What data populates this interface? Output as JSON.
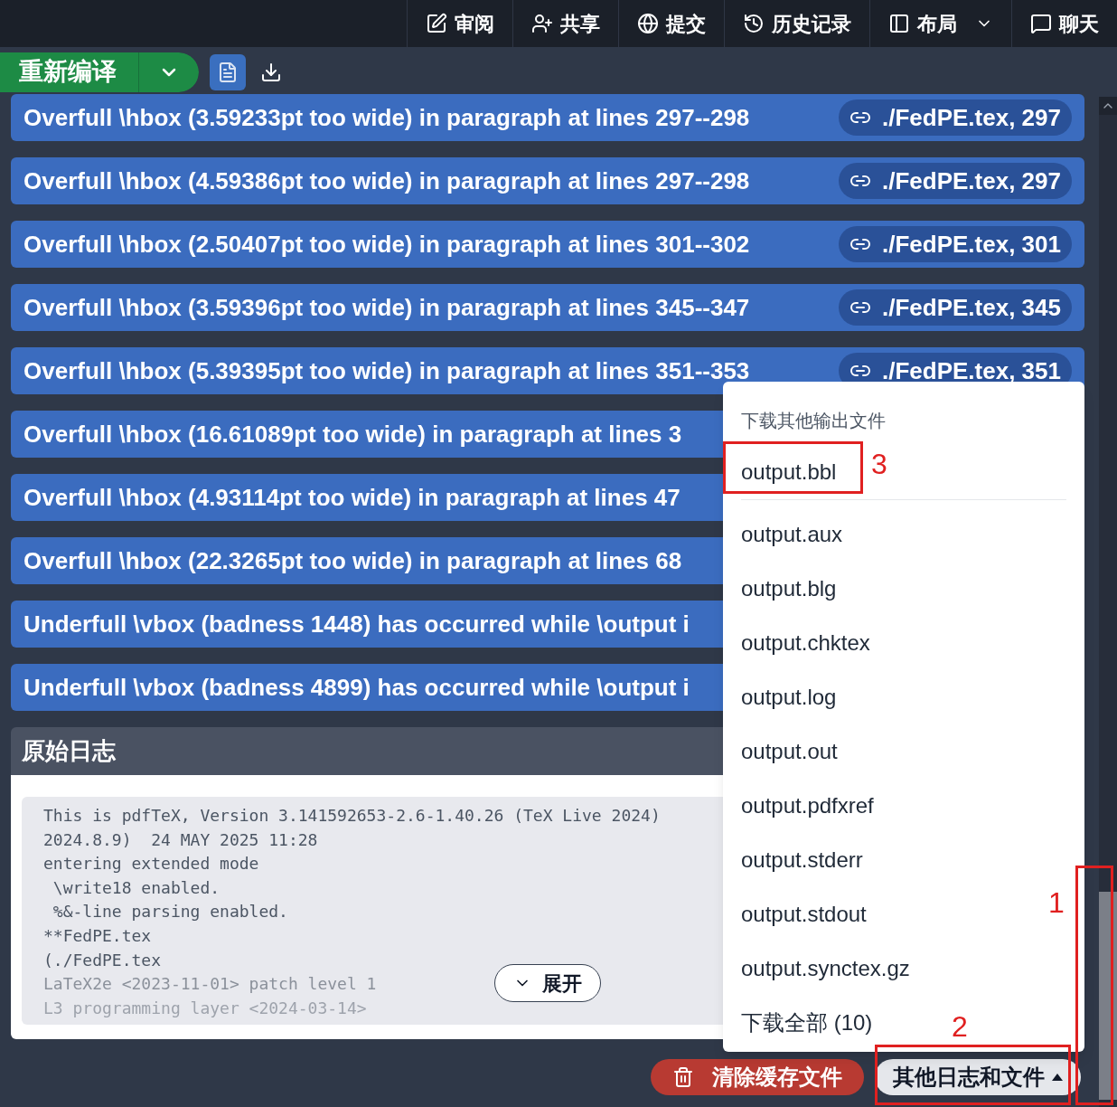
{
  "top_nav": [
    {
      "kind": "review",
      "label": "审阅"
    },
    {
      "kind": "share",
      "label": "共享"
    },
    {
      "kind": "submit",
      "label": "提交"
    },
    {
      "kind": "history",
      "label": "历史记录"
    },
    {
      "kind": "layout",
      "label": "布局"
    },
    {
      "kind": "chat",
      "label": "聊天"
    }
  ],
  "toolbar": {
    "recompile": "重新编译"
  },
  "log_entries": [
    {
      "message": "Overfull \\hbox (3.59233pt too wide) in paragraph at lines 297--298",
      "link": "./FedPE.tex, 297"
    },
    {
      "message": "Overfull \\hbox (4.59386pt too wide) in paragraph at lines 297--298",
      "link": "./FedPE.tex, 297"
    },
    {
      "message": "Overfull \\hbox (2.50407pt too wide) in paragraph at lines 301--302",
      "link": "./FedPE.tex, 301"
    },
    {
      "message": "Overfull \\hbox (3.59396pt too wide) in paragraph at lines 345--347",
      "link": "./FedPE.tex, 345"
    },
    {
      "message": "Overfull \\hbox (5.39395pt too wide) in paragraph at lines 351--353",
      "link": "./FedPE.tex, 351"
    },
    {
      "message": "Overfull \\hbox (16.61089pt too wide) in paragraph at lines 3"
    },
    {
      "message": "Overfull \\hbox (4.93114pt too wide) in paragraph at lines 47"
    },
    {
      "message": "Overfull \\hbox (22.3265pt too wide) in paragraph at lines 68"
    },
    {
      "message": "Underfull \\vbox (badness 1448) has occurred while \\output i"
    },
    {
      "message": "Underfull \\vbox (badness 4899) has occurred while \\output i"
    }
  ],
  "raw_log": {
    "title": "原始日志",
    "lines": [
      "This is pdfTeX, Version 3.141592653-2.6-1.40.26 (TeX Live 2024)",
      "2024.8.9)  24 MAY 2025 11:28",
      "entering extended mode",
      " \\write18 enabled.",
      " %&-line parsing enabled.",
      "**FedPE.tex",
      "(./FedPE.tex",
      "LaTeX2e <2023-11-01> patch level 1",
      "L3 programming layer <2024-03-14>"
    ],
    "expand": "展开"
  },
  "dropdown": {
    "title": "下载其他输出文件",
    "items": [
      "output.bbl",
      "output.aux",
      "output.blg",
      "output.chktex",
      "output.log",
      "output.out",
      "output.pdfxref",
      "output.stderr",
      "output.stdout",
      "output.synctex.gz"
    ],
    "download_all": "下载全部 (10)"
  },
  "bottom_buttons": {
    "clear_cache": "清除缓存文件",
    "other_logs": "其他日志和文件"
  },
  "annotations": [
    "1",
    "2",
    "3"
  ]
}
